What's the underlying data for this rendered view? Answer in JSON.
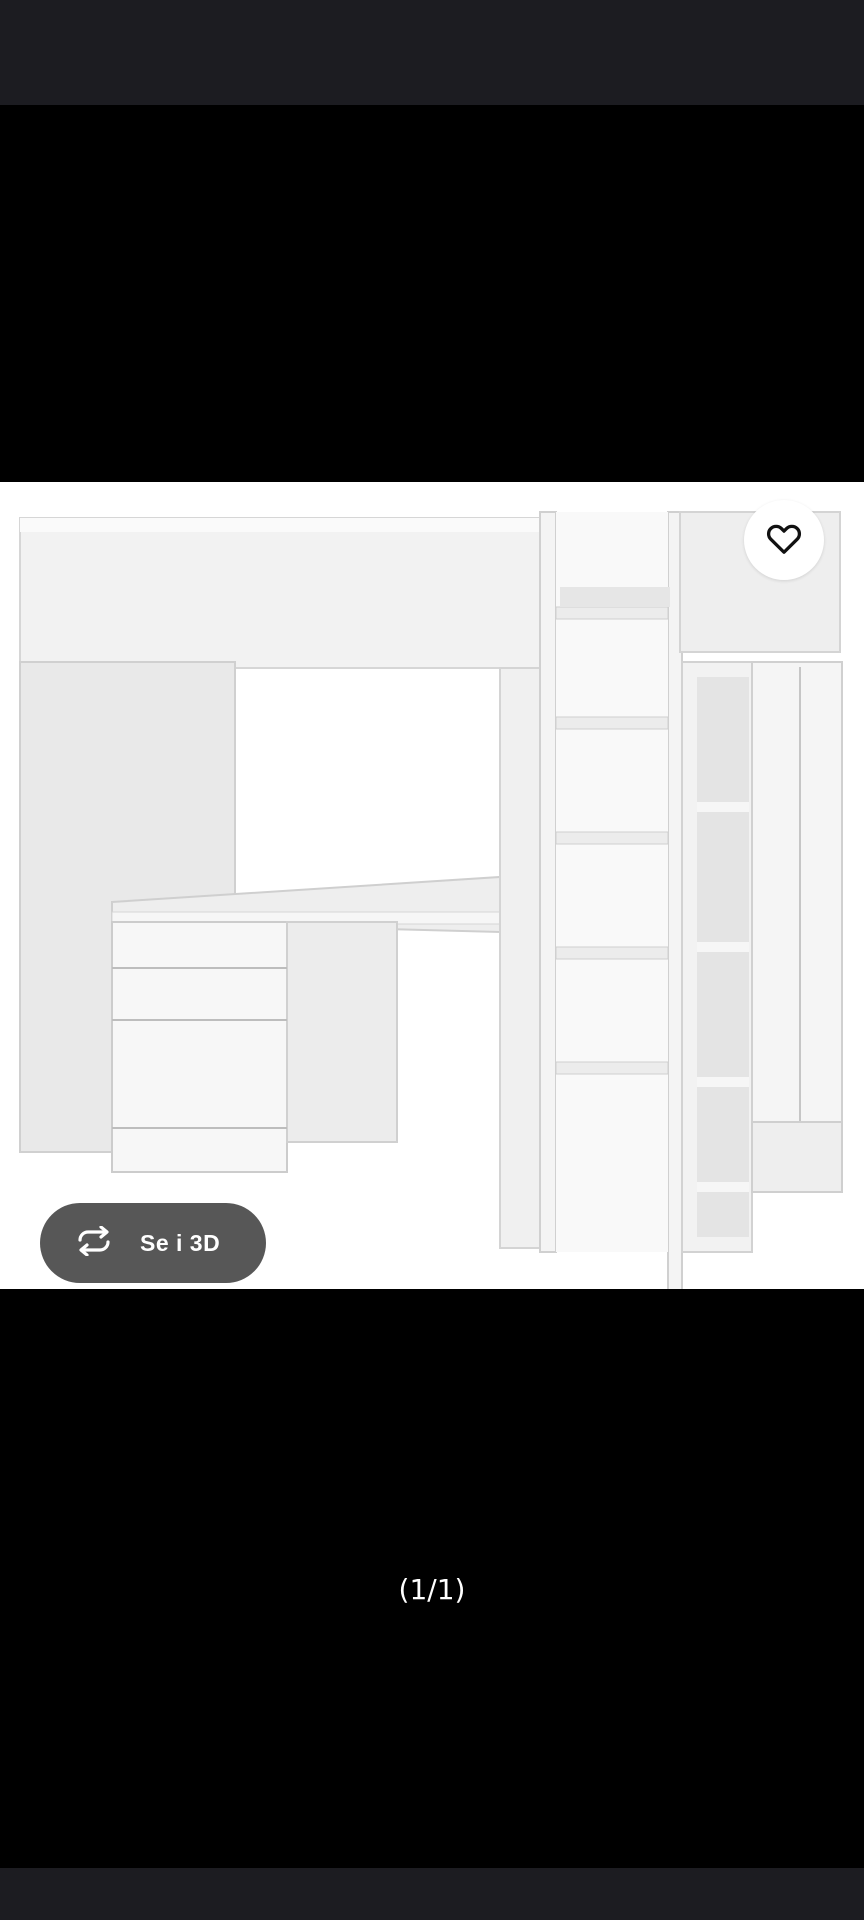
{
  "viewer": {
    "view_3d_label": "Se i 3D",
    "pager_text": "(1/1)"
  },
  "image": {
    "description": "loft-bed-with-desk-and-wardrobe"
  },
  "icons": {
    "favorite": "heart-outline-icon",
    "view_3d": "rotate-3d-icon"
  },
  "colors": {
    "background": "#000000",
    "system_bar": "#1c1c21",
    "button_bg": "#575757",
    "button_text": "#ffffff",
    "fav_bg": "#ffffff"
  }
}
